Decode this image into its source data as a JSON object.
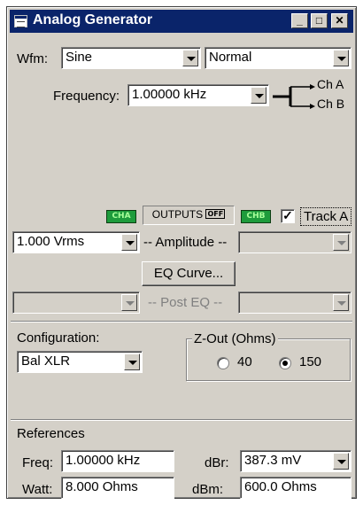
{
  "window": {
    "title": "Analog Generator"
  },
  "titlebar_buttons": {
    "minimize": "_",
    "maximize": "□",
    "close": "✕"
  },
  "waveform": {
    "label": "Wfm:",
    "value": "Sine",
    "mode": "Normal"
  },
  "frequency": {
    "label": "Frequency:",
    "value": "1.00000 kHz",
    "ch_a": "Ch A",
    "ch_b": "Ch B"
  },
  "outputs": {
    "cha": "CHA",
    "chb": "CHB",
    "label": "OUTPUTS",
    "state": "OFF",
    "track_label": "Track A",
    "track_checked": true
  },
  "amplitude": {
    "value": "1.000 Vrms",
    "label": "-- Amplitude --",
    "right_value": ""
  },
  "eq": {
    "button": "EQ Curve..."
  },
  "post_eq": {
    "label": "-- Post EQ --",
    "left_value": "",
    "right_value": ""
  },
  "configuration": {
    "label": "Configuration:",
    "value": "Bal XLR"
  },
  "zout": {
    "label": "Z-Out (Ohms)",
    "opt1": "40",
    "opt2": "150",
    "selected": "150"
  },
  "references": {
    "title": "References",
    "freq_label": "Freq:",
    "freq_value": "1.00000 kHz",
    "dbr_label": "dBr:",
    "dbr_value": "387.3  mV",
    "watt_label": "Watt:",
    "watt_value": "8.000   Ohms",
    "dbm_label": "dBm:",
    "dbm_value": "600.0   Ohms"
  },
  "colors": {
    "titlebar": "#0a246a",
    "face": "#d4d0c8",
    "led": "#1e9b3c"
  }
}
